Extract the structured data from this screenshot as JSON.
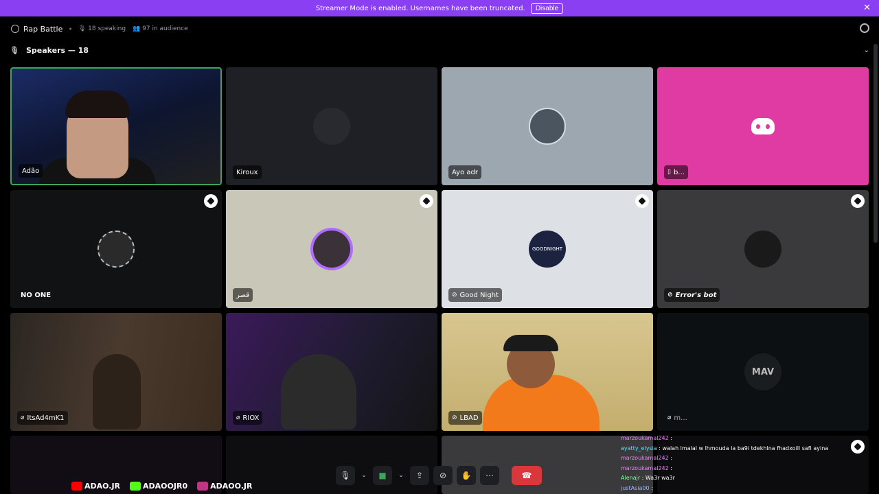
{
  "banner": {
    "text": "Streamer Mode is enabled. Usernames have been truncated.",
    "button": "Disable",
    "close": "✕"
  },
  "header": {
    "title": "Rap Battle",
    "speaking": "18 speaking",
    "audience": "97 in audience"
  },
  "section": {
    "label": "Speakers — 18",
    "chevron": "⌄",
    "mic": "🎙"
  },
  "tiles": [
    {
      "name": "Adão"
    },
    {
      "name": "Kiroux"
    },
    {
      "name": "Ayo adr"
    },
    {
      "name": "b..."
    },
    {
      "name": "NO ONE"
    },
    {
      "name": "قصر"
    },
    {
      "name": "Good Night"
    },
    {
      "name": "Error's bot"
    },
    {
      "name": "ItsAd4mK1"
    },
    {
      "name": "RIOX"
    },
    {
      "name": "LBAD"
    },
    {
      "name": "m..."
    }
  ],
  "avatar_texts": {
    "goodnight": "GOODNIGHT",
    "mav": "MAV"
  },
  "socials": [
    {
      "handle": "ADAO.JR",
      "color": "#ff0000"
    },
    {
      "handle": "ADAOOJR0",
      "color": "#53fc18"
    },
    {
      "handle": "ADAOO.JR",
      "color": "#c13584"
    }
  ],
  "chat": [
    {
      "user": "marzoukamal242",
      "text": ""
    },
    {
      "user": "ayatty_elysia",
      "text": "walah lmalal w lhmouda la ba9i tdekhlna fhadxoill safi ayina"
    },
    {
      "user": "marzoukamal242",
      "text": ""
    },
    {
      "user": "marzoukamal242",
      "text": ""
    },
    {
      "user": "Alenajr",
      "text": "Wa3r wa3r"
    },
    {
      "user": "justAsia00",
      "text": ""
    }
  ],
  "colors": {
    "accent": "#8b3ff2",
    "speaking": "#3ba55c",
    "end_call": "#da373c",
    "pink_tile": "#e03aa3"
  }
}
